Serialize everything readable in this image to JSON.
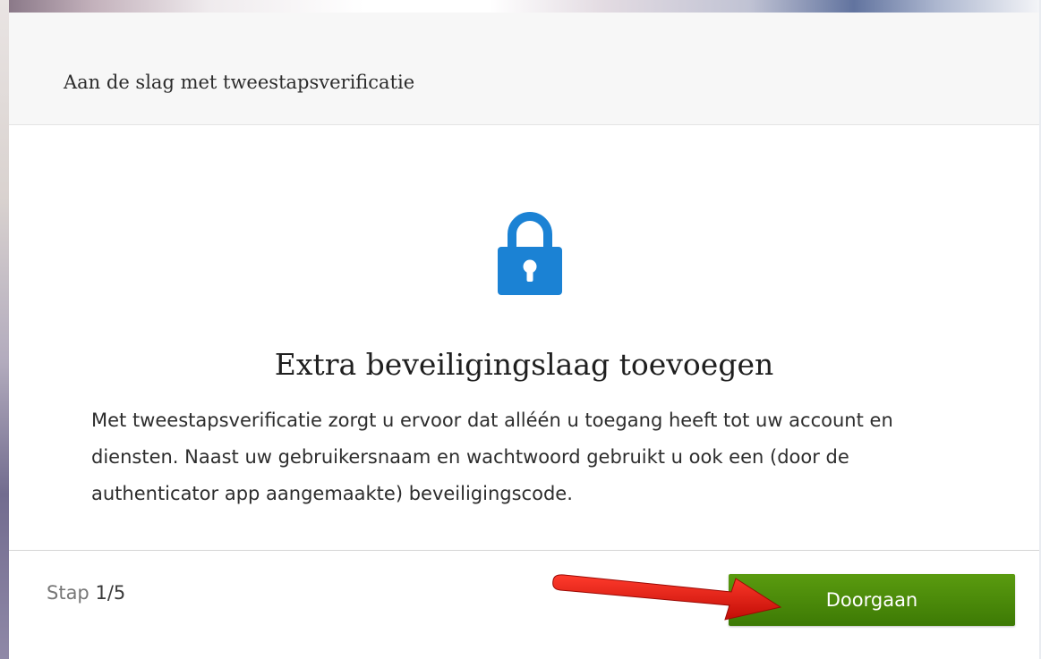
{
  "dialog": {
    "title": "Aan de slag met tweestapsverificatie",
    "icon": "lock-icon",
    "heading": "Extra beveiligingslaag toevoegen",
    "description": "Met tweestapsverificatie zorgt u ervoor dat alléén u toegang heeft tot uw account en diensten. Naast uw gebruikersnaam en wachtwoord gebruikt u ook een (door de authenticator app aangemaakte) beveiligingscode.",
    "step_prefix": "Stap",
    "step_value": "1/5",
    "continue_label": "Doorgaan"
  },
  "colors": {
    "lock": "#1b82d4",
    "button": "#4a8a0a",
    "annotation_arrow": "#e01a12"
  }
}
